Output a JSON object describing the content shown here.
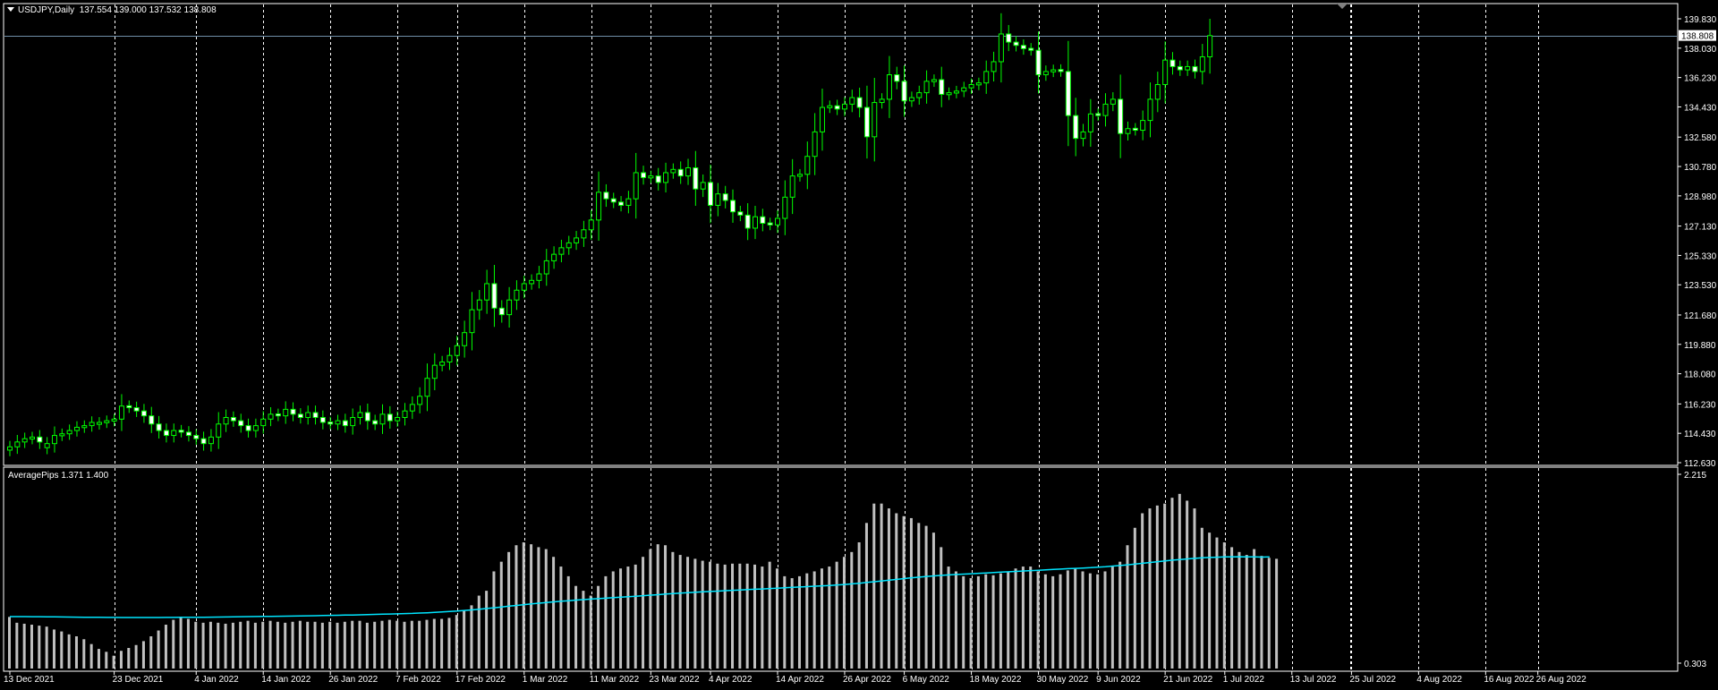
{
  "main_panel": {
    "header": {
      "symbol": "USDJPY,Daily",
      "ohlc": "137.554 139.000 137.532 138.808"
    }
  },
  "indicator_panel": {
    "header": {
      "name": "AveragePips",
      "values": "1.371 1.400"
    }
  },
  "colors": {
    "background": "#000000",
    "candle": "#00ff00",
    "bull_body": "#000000",
    "bear_body": "#ffffff",
    "histogram": "#c0c0c0",
    "ma_line": "#00e5ff",
    "grid": "#ffffff",
    "bid_line": "#6f8fa8"
  },
  "chart_data": [
    {
      "type": "candlestick",
      "y_axis_ticks": [
        "139.830",
        "138.030",
        "136.230",
        "134.430",
        "132.580",
        "130.780",
        "128.980",
        "127.130",
        "125.330",
        "123.530",
        "121.680",
        "119.880",
        "118.080",
        "116.230",
        "114.430",
        "112.630"
      ],
      "ylim": [
        112.63,
        139.83
      ],
      "current_price_label": "138.808",
      "current_price": 138.808,
      "x_tick_labels": [
        "13 Dec 2021",
        "23 Dec 2021",
        "4 Jan 2022",
        "14 Jan 2022",
        "26 Jan 2022",
        "7 Feb 2022",
        "17 Feb 2022",
        "1 Mar 2022",
        "11 Mar 2022",
        "23 Mar 2022",
        "4 Apr 2022",
        "14 Apr 2022",
        "26 Apr 2022",
        "6 May 2022",
        "18 May 2022",
        "30 May 2022",
        "9 Jun 2022",
        "21 Jun 2022",
        "1 Jul 2022",
        "13 Jul 2022",
        "25 Jul 2022",
        "4 Aug 2022",
        "16 Aug 2022",
        "26 Aug 2022"
      ],
      "close": [
        113.6,
        113.9,
        114.1,
        114.2,
        113.9,
        113.8,
        114.3,
        114.4,
        114.6,
        114.8,
        114.9,
        115.1,
        115.1,
        115.2,
        115.3,
        116.1,
        116.0,
        115.8,
        115.5,
        115.0,
        114.6,
        114.3,
        114.6,
        114.5,
        114.3,
        114.1,
        113.8,
        114.2,
        115.0,
        115.4,
        115.2,
        114.9,
        114.6,
        114.9,
        115.3,
        115.6,
        115.5,
        115.9,
        115.6,
        115.4,
        115.7,
        115.4,
        115.1,
        115.0,
        115.2,
        114.9,
        115.4,
        115.7,
        115.2,
        115.0,
        115.6,
        115.2,
        115.4,
        115.8,
        116.2,
        116.7,
        117.8,
        118.6,
        118.8,
        119.2,
        119.8,
        120.6,
        122.0,
        122.6,
        123.6,
        122.1,
        121.7,
        122.6,
        123.2,
        123.6,
        123.8,
        124.2,
        125.0,
        125.4,
        125.8,
        126.1,
        126.4,
        126.9,
        127.5,
        129.2,
        128.8,
        128.6,
        128.4,
        128.8,
        130.4,
        130.1,
        130.2,
        129.8,
        130.4,
        130.6,
        130.2,
        130.7,
        129.4,
        129.8,
        128.4,
        129.1,
        128.7,
        128.0,
        127.8,
        127.0,
        127.7,
        127.3,
        127.2,
        127.6,
        128.9,
        130.2,
        130.3,
        131.4,
        132.9,
        134.4,
        134.5,
        134.3,
        134.6,
        135.0,
        134.4,
        132.6,
        134.7,
        134.9,
        136.4,
        136.0,
        134.8,
        135.0,
        135.3,
        136.0,
        136.1,
        135.2,
        135.3,
        135.4,
        135.6,
        135.8,
        135.9,
        136.6,
        137.2,
        138.9,
        138.4,
        138.2,
        138.0,
        137.9,
        136.4,
        136.6,
        136.7,
        136.6,
        133.9,
        132.5,
        132.9,
        134.0,
        133.9,
        134.6,
        134.9,
        132.8,
        133.1,
        133.0,
        133.6,
        134.9,
        135.8,
        137.3,
        136.9,
        136.7,
        136.9,
        136.6,
        137.5,
        138.8
      ],
      "bearish": [
        false,
        false,
        false,
        false,
        true,
        false,
        false,
        false,
        false,
        false,
        false,
        false,
        false,
        false,
        false,
        false,
        true,
        true,
        true,
        true,
        true,
        true,
        false,
        true,
        true,
        true,
        true,
        false,
        false,
        false,
        true,
        true,
        true,
        false,
        false,
        false,
        true,
        false,
        true,
        true,
        false,
        true,
        true,
        true,
        false,
        true,
        false,
        false,
        true,
        true,
        false,
        true,
        false,
        false,
        false,
        false,
        false,
        false,
        false,
        false,
        false,
        false,
        false,
        false,
        false,
        true,
        true,
        false,
        false,
        false,
        false,
        false,
        false,
        false,
        false,
        false,
        false,
        false,
        false,
        false,
        true,
        true,
        true,
        false,
        false,
        true,
        false,
        true,
        false,
        false,
        true,
        false,
        true,
        false,
        true,
        false,
        true,
        true,
        true,
        true,
        false,
        true,
        true,
        false,
        false,
        false,
        false,
        false,
        false,
        false,
        false,
        true,
        false,
        false,
        true,
        true,
        false,
        false,
        false,
        true,
        true,
        false,
        false,
        false,
        false,
        true,
        false,
        false,
        false,
        false,
        false,
        false,
        false,
        false,
        true,
        true,
        true,
        true,
        true,
        false,
        false,
        true,
        true,
        true,
        false,
        false,
        true,
        false,
        false,
        true,
        false,
        true,
        false,
        false,
        false,
        false,
        true,
        true,
        false,
        true,
        false,
        false
      ]
    },
    {
      "type": "bar",
      "name": "AveragePips",
      "ylim": [
        0.303,
        2.215
      ],
      "y_axis_ticks": [
        "2.215",
        "0.303"
      ],
      "values": [
        0.78,
        0.72,
        0.71,
        0.7,
        0.69,
        0.68,
        0.65,
        0.63,
        0.6,
        0.58,
        0.55,
        0.5,
        0.45,
        0.42,
        0.38,
        0.43,
        0.46,
        0.49,
        0.53,
        0.58,
        0.64,
        0.7,
        0.75,
        0.77,
        0.76,
        0.73,
        0.72,
        0.73,
        0.72,
        0.71,
        0.72,
        0.73,
        0.74,
        0.72,
        0.73,
        0.74,
        0.73,
        0.72,
        0.73,
        0.74,
        0.73,
        0.73,
        0.72,
        0.73,
        0.72,
        0.73,
        0.74,
        0.74,
        0.72,
        0.73,
        0.74,
        0.75,
        0.74,
        0.73,
        0.74,
        0.74,
        0.75,
        0.76,
        0.76,
        0.77,
        0.8,
        0.85,
        0.9,
        1.0,
        1.05,
        1.25,
        1.35,
        1.45,
        1.52,
        1.55,
        1.53,
        1.5,
        1.48,
        1.4,
        1.3,
        1.2,
        1.1,
        1.05,
        1.0,
        1.1,
        1.2,
        1.25,
        1.28,
        1.3,
        1.32,
        1.4,
        1.48,
        1.53,
        1.52,
        1.45,
        1.42,
        1.4,
        1.38,
        1.36,
        1.35,
        1.33,
        1.32,
        1.33,
        1.33,
        1.33,
        1.32,
        1.3,
        1.35,
        1.28,
        1.2,
        1.18,
        1.2,
        1.23,
        1.25,
        1.28,
        1.3,
        1.35,
        1.4,
        1.45,
        1.55,
        1.75,
        1.95,
        1.95,
        1.9,
        1.85,
        1.82,
        1.8,
        1.75,
        1.72,
        1.65,
        1.5,
        1.3,
        1.25,
        1.2,
        1.18,
        1.2,
        1.22,
        1.21,
        1.23,
        1.25,
        1.28,
        1.3,
        1.3,
        1.25,
        1.22,
        1.2,
        1.22,
        1.26,
        1.28,
        1.25,
        1.23,
        1.22,
        1.25,
        1.3,
        1.35,
        1.52,
        1.7,
        1.85,
        1.9,
        1.93,
        1.95,
        2.01,
        2.05,
        1.98,
        1.9,
        1.7,
        1.65,
        1.6,
        1.55,
        1.5,
        1.45,
        1.42,
        1.48,
        1.41,
        1.39,
        1.38
      ],
      "ma_values": [
        0.783,
        0.783,
        0.783,
        0.782,
        0.782,
        0.781,
        0.781,
        0.78,
        0.779,
        0.778,
        0.777,
        0.777,
        0.776,
        0.775,
        0.775,
        0.774,
        0.774,
        0.774,
        0.774,
        0.774,
        0.774,
        0.775,
        0.775,
        0.776,
        0.776,
        0.777,
        0.777,
        0.778,
        0.779,
        0.78,
        0.781,
        0.782,
        0.783,
        0.784,
        0.785,
        0.786,
        0.787,
        0.788,
        0.789,
        0.79,
        0.792,
        0.793,
        0.794,
        0.796,
        0.797,
        0.799,
        0.8,
        0.802,
        0.804,
        0.806,
        0.808,
        0.81,
        0.812,
        0.815,
        0.817,
        0.82,
        0.823,
        0.827,
        0.831,
        0.836,
        0.841,
        0.847,
        0.853,
        0.86,
        0.867,
        0.875,
        0.883,
        0.891,
        0.899,
        0.907,
        0.915,
        0.922,
        0.929,
        0.936,
        0.942,
        0.948,
        0.954,
        0.959,
        0.964,
        0.969,
        0.974,
        0.979,
        0.984,
        0.989,
        0.994,
        0.999,
        1.005,
        1.01,
        1.016,
        1.021,
        1.026,
        1.031,
        1.035,
        1.039,
        1.043,
        1.047,
        1.051,
        1.055,
        1.058,
        1.062,
        1.066,
        1.069,
        1.073,
        1.077,
        1.081,
        1.085,
        1.089,
        1.093,
        1.097,
        1.101,
        1.105,
        1.11,
        1.115,
        1.121,
        1.128,
        1.136,
        1.144,
        1.152,
        1.16,
        1.168,
        1.176,
        1.184,
        1.191,
        1.198,
        1.204,
        1.209,
        1.214,
        1.218,
        1.222,
        1.226,
        1.23,
        1.234,
        1.238,
        1.242,
        1.246,
        1.25,
        1.254,
        1.258,
        1.262,
        1.266,
        1.27,
        1.274,
        1.278,
        1.281,
        1.285,
        1.289,
        1.294,
        1.299,
        1.305,
        1.311,
        1.318,
        1.326,
        1.334,
        1.342,
        1.35,
        1.358,
        1.366,
        1.373,
        1.379,
        1.385,
        1.39,
        1.394,
        1.397,
        1.399,
        1.4,
        1.401,
        1.4,
        1.399,
        1.398,
        1.4
      ]
    }
  ]
}
